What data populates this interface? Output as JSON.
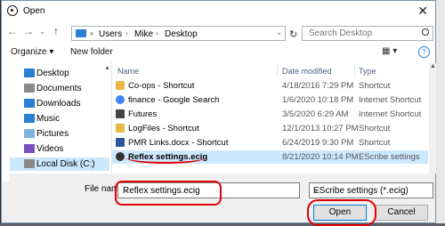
{
  "window": {
    "title": "Open",
    "close_icon": "✕"
  },
  "nav": {
    "back": "←",
    "forward": "→",
    "dropdown": "⌄",
    "up": "↑",
    "breadcrumb": [
      "Users",
      "Mike",
      "Desktop"
    ],
    "search_placeholder": "Search Desktop"
  },
  "toolbar": {
    "organize": "Organize ▾",
    "new_folder": "New folder",
    "view_icon": "▦ ▾",
    "help_icon": "?"
  },
  "sidebar": {
    "items": [
      {
        "label": "Desktop",
        "icon": "desktop-icon",
        "color": "#2a7fd4"
      },
      {
        "label": "Documents",
        "icon": "documents-icon",
        "color": "#8a8a8a"
      },
      {
        "label": "Downloads",
        "icon": "downloads-icon",
        "color": "#2a7fd4"
      },
      {
        "label": "Music",
        "icon": "music-icon",
        "color": "#2a7fd4"
      },
      {
        "label": "Pictures",
        "icon": "pictures-icon",
        "color": "#7fb2e0"
      },
      {
        "label": "Videos",
        "icon": "videos-icon",
        "color": "#7a4fc0"
      },
      {
        "label": "Local Disk (C:)",
        "icon": "disk-icon",
        "color": "#8a8a8a"
      }
    ]
  },
  "columns": {
    "name": "Name",
    "date": "Date modified",
    "type": "Type"
  },
  "files": [
    {
      "name": "Co-ops - Shortcut",
      "date": "4/18/2016 7:29 PM",
      "type": "Shortcut",
      "icon": "folder-shortcut-icon",
      "color": "#e8b84a"
    },
    {
      "name": "finance - Google Search",
      "date": "1/6/2020 10:18 PM",
      "type": "Internet Shortcut",
      "icon": "google-icon",
      "color": "#4285f4"
    },
    {
      "name": "Futures",
      "date": "3/5/2020 6:29 AM",
      "type": "Internet Shortcut",
      "icon": "web-icon",
      "color": "#444444"
    },
    {
      "name": "LogFiles - Shortcut",
      "date": "12/1/2013 10:27 PM",
      "type": "Shortcut",
      "icon": "folder-shortcut-icon",
      "color": "#e8b84a"
    },
    {
      "name": "PMR Links.docx - Shortcut",
      "date": "6/24/2019 9:30 PM",
      "type": "Shortcut",
      "icon": "doc-shortcut-icon",
      "color": "#2b579a"
    },
    {
      "name": "Reflex settings.ecig",
      "date": "8/21/2020 10:14 PM",
      "type": "EScribe settings",
      "icon": "escribe-icon",
      "color": "#333333",
      "selected": true
    }
  ],
  "footer": {
    "file_name_label": "File name:",
    "file_name_value": "Reflex settings.ecig",
    "file_type_value": "EScribe settings (*.ecig)",
    "open_label": "Open",
    "cancel_label": "Cancel"
  },
  "colors": {
    "selection": "#cce8ff",
    "annotation": "#e00000",
    "accent": "#0078d7"
  }
}
